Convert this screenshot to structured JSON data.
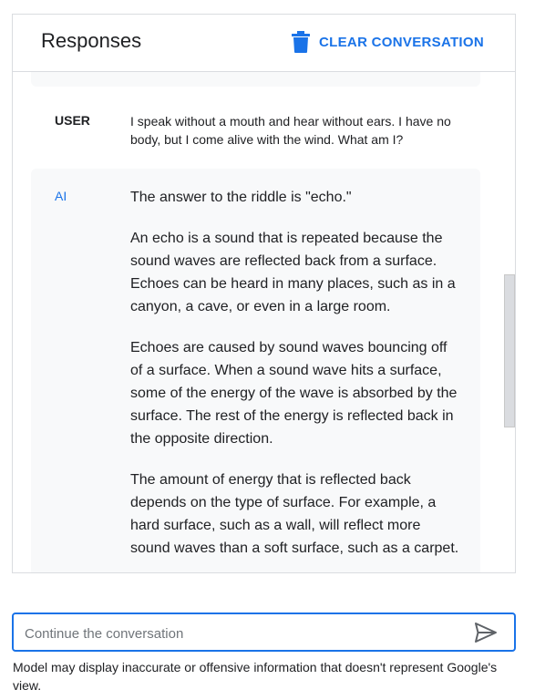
{
  "header": {
    "title": "Responses",
    "clear_label": "CLEAR CONVERSATION",
    "clear_icon": "trash-icon"
  },
  "conversation": {
    "user": {
      "role": "USER",
      "text": "I speak without a mouth and hear without ears. I have no body, but I come alive with the wind. What am I?"
    },
    "ai": {
      "role": "AI",
      "paragraphs": [
        "The answer to the riddle is \"echo.\"",
        "An echo is a sound that is repeated because the sound waves are reflected back from a surface. Echoes can be heard in many places, such as in a canyon, a cave, or even in a large room.",
        "Echoes are caused by sound waves bouncing off of a surface. When a sound wave hits a surface, some of the energy of the wave is absorbed by the surface. The rest of the energy is reflected back in the opposite direction.",
        "The amount of energy that is reflected back depends on the type of surface. For example, a hard surface, such as a wall, will reflect more sound waves than a soft surface, such as a carpet."
      ]
    }
  },
  "input": {
    "placeholder": "Continue the conversation",
    "value": "",
    "send_icon": "send-icon"
  },
  "disclaimer": "Model may display inaccurate or offensive information that doesn't represent Google's view.",
  "colors": {
    "accent": "#1a73e8",
    "card_bg": "#f8f9fa",
    "border": "#dadce0",
    "text": "#202124"
  }
}
